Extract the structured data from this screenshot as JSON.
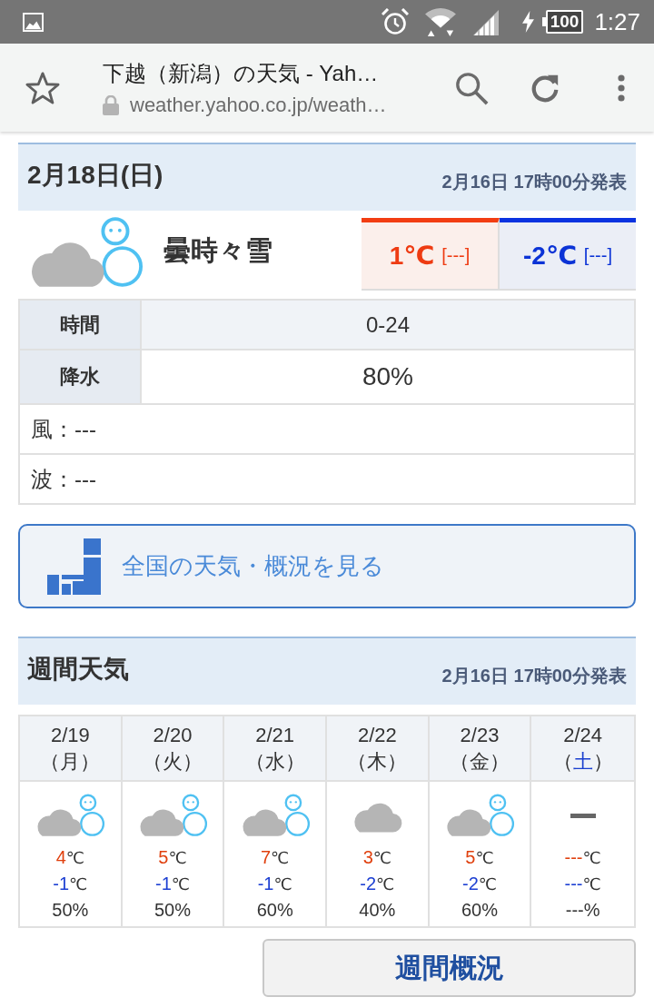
{
  "status_bar": {
    "battery": "100",
    "time": "1:27"
  },
  "browser": {
    "title": "下越（新潟）の天気 - Yah…",
    "url": "weather.yahoo.co.jp/weath…"
  },
  "today": {
    "date": "2月18日(日)",
    "issued": "2月16日 17時00分発表",
    "icon": {
      "kind": "cloud-snow"
    },
    "condition": "曇時々雪",
    "high": {
      "value": "1℃",
      "diff": "[---]"
    },
    "low": {
      "value": "-2℃",
      "diff": "[---]"
    },
    "rows": [
      {
        "kind": "time",
        "label": "時間",
        "value": "0-24"
      },
      {
        "kind": "precip",
        "label": "降水",
        "value": "80%"
      }
    ],
    "notes": [
      "風：---",
      "波：---"
    ]
  },
  "nationwide_link": {
    "label": "全国の天気・概況を見る"
  },
  "weekly": {
    "title": "週間天気",
    "issued": "2月16日 17時00分発表",
    "days": [
      {
        "date": "2/19",
        "weekday": {
          "open": "（",
          "name": "月",
          "close": "）"
        },
        "color": "#333333",
        "kind": "cloud-snow",
        "high": {
          "value": "4",
          "unit": "℃"
        },
        "low": {
          "value": "-1",
          "unit": "℃"
        },
        "precip": {
          "value": "50",
          "unit": "%"
        }
      },
      {
        "date": "2/20",
        "weekday": {
          "open": "（",
          "name": "火",
          "close": "）"
        },
        "color": "#333333",
        "kind": "cloud-snow",
        "high": {
          "value": "5",
          "unit": "℃"
        },
        "low": {
          "value": "-1",
          "unit": "℃"
        },
        "precip": {
          "value": "50",
          "unit": "%"
        }
      },
      {
        "date": "2/21",
        "weekday": {
          "open": "（",
          "name": "水",
          "close": "）"
        },
        "color": "#333333",
        "kind": "cloud-snow",
        "high": {
          "value": "7",
          "unit": "℃"
        },
        "low": {
          "value": "-1",
          "unit": "℃"
        },
        "precip": {
          "value": "60",
          "unit": "%"
        }
      },
      {
        "date": "2/22",
        "weekday": {
          "open": "（",
          "name": "木",
          "close": "）"
        },
        "color": "#333333",
        "kind": "cloud",
        "high": {
          "value": "3",
          "unit": "℃"
        },
        "low": {
          "value": "-2",
          "unit": "℃"
        },
        "precip": {
          "value": "40",
          "unit": "%"
        }
      },
      {
        "date": "2/23",
        "weekday": {
          "open": "（",
          "name": "金",
          "close": "）"
        },
        "color": "#333333",
        "kind": "cloud-snow",
        "high": {
          "value": "5",
          "unit": "℃"
        },
        "low": {
          "value": "-2",
          "unit": "℃"
        },
        "precip": {
          "value": "60",
          "unit": "%"
        }
      },
      {
        "date": "2/24",
        "weekday": {
          "open": "（",
          "name": "土",
          "close": "）"
        },
        "color": "#1a3fcf",
        "kind": "unavailable",
        "high": {
          "value": "---",
          "unit": "℃"
        },
        "low": {
          "value": "---",
          "unit": "℃"
        },
        "precip": {
          "value": "---",
          "unit": "%"
        }
      }
    ],
    "button": "週間概況"
  }
}
